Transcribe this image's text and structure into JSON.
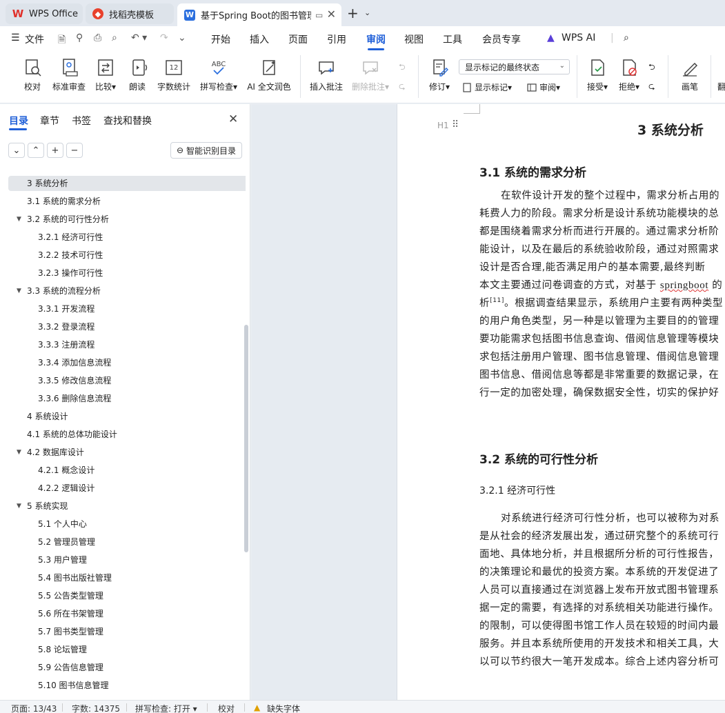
{
  "tabs": {
    "wps_office": "WPS Office",
    "template": "找稻壳模板",
    "document": "基于Spring Boot的图书管理"
  },
  "menu": {
    "file": "文件",
    "items": [
      "开始",
      "插入",
      "页面",
      "引用",
      "审阅",
      "视图",
      "工具",
      "会员专享"
    ],
    "active": "审阅",
    "wps_ai": "WPS AI"
  },
  "ribbon": {
    "proofread": "校对",
    "standard_review": "标准审查",
    "compare": "比较",
    "read_aloud": "朗读",
    "word_count": "字数统计",
    "spell_check": "拼写检查",
    "ai_polish": "AI 全文润色",
    "insert_comment": "插入批注",
    "delete_comment": "删除批注",
    "track_changes": "修订",
    "markup_select": "显示标记的最终状态",
    "show_markup": "显示标记",
    "review": "审阅",
    "accept": "接受",
    "reject": "拒绝",
    "pen": "画笔",
    "more": "翻"
  },
  "nav": {
    "tabs": [
      "目录",
      "章节",
      "书签",
      "查找和替换"
    ],
    "active_tab": "目录",
    "smart_toc": "智能识别目录",
    "toc": [
      {
        "label": "3 系统分析",
        "level": 1,
        "selected": true,
        "arrow": false
      },
      {
        "label": "3.1 系统的需求分析",
        "level": 2,
        "arrow": false
      },
      {
        "label": "3.2 系统的可行性分析",
        "level": 2,
        "arrow": true
      },
      {
        "label": "3.2.1 经济可行性",
        "level": 3,
        "arrow": false
      },
      {
        "label": "3.2.2 技术可行性",
        "level": 3,
        "arrow": false
      },
      {
        "label": "3.2.3 操作可行性",
        "level": 3,
        "arrow": false
      },
      {
        "label": "3.3 系统的流程分析",
        "level": 2,
        "arrow": true
      },
      {
        "label": "3.3.1 开发流程",
        "level": 3,
        "arrow": false
      },
      {
        "label": "3.3.2 登录流程",
        "level": 3,
        "arrow": false
      },
      {
        "label": "3.3.3 注册流程",
        "level": 3,
        "arrow": false
      },
      {
        "label": "3.3.4 添加信息流程",
        "level": 3,
        "arrow": false
      },
      {
        "label": "3.3.5 修改信息流程",
        "level": 3,
        "arrow": false
      },
      {
        "label": "3.3.6 删除信息流程",
        "level": 3,
        "arrow": false
      },
      {
        "label": "4 系统设计",
        "level": 1,
        "arrow": false
      },
      {
        "label": "4.1 系统的总体功能设计",
        "level": 2,
        "arrow": false
      },
      {
        "label": "4.2 数据库设计",
        "level": 2,
        "arrow": true
      },
      {
        "label": "4.2.1 概念设计",
        "level": 3,
        "arrow": false
      },
      {
        "label": "4.2.2 逻辑设计",
        "level": 3,
        "arrow": false
      },
      {
        "label": "5 系统实现",
        "level": 2,
        "arrow": true
      },
      {
        "label": "5.1 个人中心",
        "level": 3,
        "arrow": false
      },
      {
        "label": "5.2 管理员管理",
        "level": 3,
        "arrow": false
      },
      {
        "label": "5.3 用户管理",
        "level": 3,
        "arrow": false
      },
      {
        "label": "5.4 图书出版社管理",
        "level": 3,
        "arrow": false
      },
      {
        "label": "5.5 公告类型管理",
        "level": 3,
        "arrow": false
      },
      {
        "label": "5.6 所在书架管理",
        "level": 3,
        "arrow": false
      },
      {
        "label": "5.7 图书类型管理",
        "level": 3,
        "arrow": false
      },
      {
        "label": "5.8 论坛管理",
        "level": 3,
        "arrow": false
      },
      {
        "label": "5.9 公告信息管理",
        "level": 3,
        "arrow": false
      },
      {
        "label": "5.10 图书信息管理",
        "level": 3,
        "arrow": false
      }
    ]
  },
  "document": {
    "h1_marker": "H1",
    "heading": "3 系统分析",
    "section_31": "3.1 系统的需求分析",
    "section_31_lines": [
      "在软件设计开发的整个过程中，需求分析占用的",
      "耗费人力的阶段。需求分析是设计系统功能模块的总",
      "都是围绕着需求分析而进行开展的。通过需求分析阶",
      "能设计，以及在最后的系统验收阶段，通过对照需求",
      "设计是否合理,能否满足用户的基本需要,最终判断",
      "本文主要通过问卷调查的方式，对基于 ",
      "析",
      "的用户角色类型，另一种是以管理为主要目的的管理",
      "要功能需求包括图书信息查询、借阅信息管理等模块",
      "求包括注册用户管理、图书信息管理、借阅信息管理",
      "图书信息、借阅信息等都是非常重要的数据记录，在",
      "行一定的加密处理，确保数据安全性，切实的保护好"
    ],
    "springboot": "springboot",
    "springboot_tail": " 的",
    "cite": "[11]",
    "line7_tail": "。根据调查结果显示，系统用户主要有两种类型",
    "section_32": "3.2 系统的可行性分析",
    "section_321": "3.2.1 经济可行性",
    "section_321_lines": [
      "对系统进行经济可行性分析，也可以被称为对系",
      "是从社会的经济发展出发，通过研究整个的系统可行",
      "面地、具体地分析，并且根据所分析的可行性报告，",
      "的决策理论和最优的投资方案。本系统的开发促进了",
      "人员可以直接通过在浏览器上发布开放式图书管理系",
      "据一定的需要，有选择的对系统相关功能进行操作。",
      "的限制，可以使得图书馆工作人员在较短的时间内最",
      "服务。并且本系统所使用的开发技术和相关工具，大",
      "以可以节约很大一笔开发成本。综合上述内容分析可"
    ]
  },
  "status": {
    "page": "页面: 13/43",
    "words": "字数: 14375",
    "spell": "拼写检查: 打开",
    "proof": "校对",
    "missing_font": "缺失字体"
  },
  "colors": {
    "accent": "#1f5fd8",
    "selected_bg": "#e3e6ea"
  }
}
